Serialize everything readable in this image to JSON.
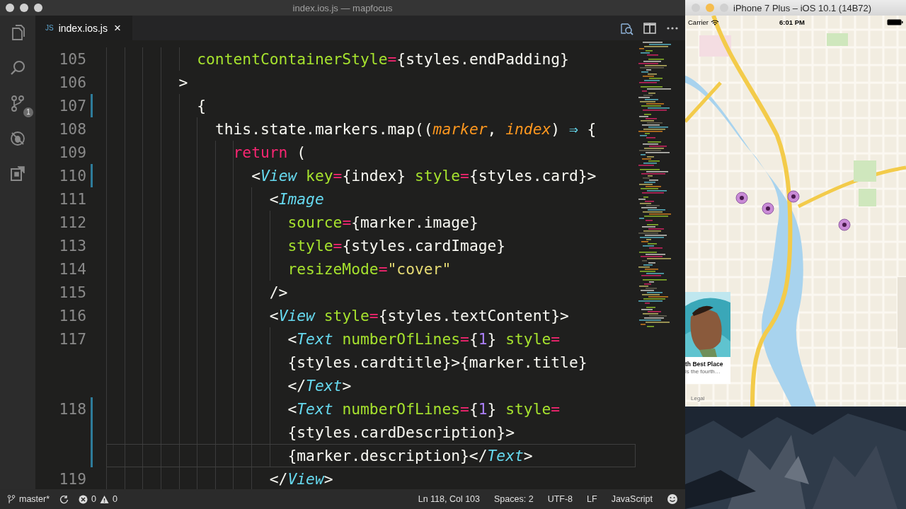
{
  "editor_window": {
    "title": "index.ios.js — mapfocus",
    "activity_bar": [
      {
        "kind": "files"
      },
      {
        "kind": "search"
      },
      {
        "kind": "git",
        "badge": "1"
      },
      {
        "kind": "debug"
      },
      {
        "kind": "extensions"
      }
    ],
    "tabs": [
      {
        "icon_text": "JS",
        "label": "index.ios.js",
        "close": "×",
        "selected": true
      }
    ],
    "editor_actions": [
      {
        "kind": "find"
      },
      {
        "kind": "split"
      },
      {
        "kind": "more"
      }
    ],
    "lines": [
      {
        "number": "105",
        "modified": false,
        "current": false,
        "tokens": [
          {
            "text": "          contentContainerStyle",
            "kind": "attr"
          },
          {
            "text": "=",
            "kind": "op"
          },
          {
            "text": "{styles.endPadding}",
            "kind": "punct"
          }
        ]
      },
      {
        "number": "106",
        "modified": false,
        "current": false,
        "tokens": [
          {
            "text": "        >",
            "kind": "punct"
          }
        ]
      },
      {
        "number": "107",
        "modified": true,
        "current": false,
        "tokens": [
          {
            "text": "          {",
            "kind": "punct"
          }
        ]
      },
      {
        "number": "108",
        "modified": false,
        "current": false,
        "tokens": [
          {
            "text": "            this.state.markers.map((",
            "kind": "punct"
          },
          {
            "text": "marker",
            "kind": "param"
          },
          {
            "text": ", ",
            "kind": "punct"
          },
          {
            "text": "index",
            "kind": "param"
          },
          {
            "text": ") ",
            "kind": "punct"
          },
          {
            "text": "⇒",
            "kind": "arrow"
          },
          {
            "text": " {",
            "kind": "punct"
          }
        ]
      },
      {
        "number": "109",
        "modified": false,
        "current": false,
        "tokens": [
          {
            "text": "              return",
            "kind": "keyword"
          },
          {
            "text": " (",
            "kind": "punct"
          }
        ]
      },
      {
        "number": "110",
        "modified": true,
        "current": false,
        "tokens": [
          {
            "text": "                <",
            "kind": "punct"
          },
          {
            "text": "View",
            "kind": "tag"
          },
          {
            "text": " key",
            "kind": "attr"
          },
          {
            "text": "=",
            "kind": "op"
          },
          {
            "text": "{index} ",
            "kind": "punct"
          },
          {
            "text": "style",
            "kind": "attr"
          },
          {
            "text": "=",
            "kind": "op"
          },
          {
            "text": "{styles.card}>",
            "kind": "punct"
          }
        ]
      },
      {
        "number": "111",
        "modified": false,
        "current": false,
        "tokens": [
          {
            "text": "                  <",
            "kind": "punct"
          },
          {
            "text": "Image",
            "kind": "tag"
          }
        ]
      },
      {
        "number": "112",
        "modified": false,
        "current": false,
        "tokens": [
          {
            "text": "                    source",
            "kind": "attr"
          },
          {
            "text": "=",
            "kind": "op"
          },
          {
            "text": "{marker.image}",
            "kind": "punct"
          }
        ]
      },
      {
        "number": "113",
        "modified": false,
        "current": false,
        "tokens": [
          {
            "text": "                    style",
            "kind": "attr"
          },
          {
            "text": "=",
            "kind": "op"
          },
          {
            "text": "{styles.cardImage}",
            "kind": "punct"
          }
        ]
      },
      {
        "number": "114",
        "modified": false,
        "current": false,
        "tokens": [
          {
            "text": "                    resizeMode",
            "kind": "attr"
          },
          {
            "text": "=",
            "kind": "op"
          },
          {
            "text": "\"cover\"",
            "kind": "string"
          }
        ]
      },
      {
        "number": "115",
        "modified": false,
        "current": false,
        "tokens": [
          {
            "text": "                  />",
            "kind": "punct"
          }
        ]
      },
      {
        "number": "116",
        "modified": false,
        "current": false,
        "tokens": [
          {
            "text": "                  <",
            "kind": "punct"
          },
          {
            "text": "View",
            "kind": "tag"
          },
          {
            "text": " style",
            "kind": "attr"
          },
          {
            "text": "=",
            "kind": "op"
          },
          {
            "text": "{styles.textContent}>",
            "kind": "punct"
          }
        ]
      },
      {
        "number": "117",
        "modified": false,
        "current": false,
        "tokens": [
          {
            "text": "                    <",
            "kind": "punct"
          },
          {
            "text": "Text",
            "kind": "tag"
          },
          {
            "text": " numberOfLines",
            "kind": "attr"
          },
          {
            "text": "=",
            "kind": "op"
          },
          {
            "text": "{",
            "kind": "punct"
          },
          {
            "text": "1",
            "kind": "number"
          },
          {
            "text": "} ",
            "kind": "punct"
          },
          {
            "text": "style",
            "kind": "attr"
          },
          {
            "text": "=",
            "kind": "op"
          }
        ]
      },
      {
        "modified": false,
        "current": false,
        "tokens": [
          {
            "text": "                    {styles.cardtitle}>{marker.title}",
            "kind": "punct"
          }
        ]
      },
      {
        "modified": false,
        "current": false,
        "tokens": [
          {
            "text": "                    </",
            "kind": "punct"
          },
          {
            "text": "Text",
            "kind": "tag"
          },
          {
            "text": ">",
            "kind": "punct"
          }
        ]
      },
      {
        "number": "118",
        "modified": true,
        "current": false,
        "tokens": [
          {
            "text": "                    <",
            "kind": "punct"
          },
          {
            "text": "Text",
            "kind": "tag"
          },
          {
            "text": " numberOfLines",
            "kind": "attr"
          },
          {
            "text": "=",
            "kind": "op"
          },
          {
            "text": "{",
            "kind": "punct"
          },
          {
            "text": "1",
            "kind": "number"
          },
          {
            "text": "} ",
            "kind": "punct"
          },
          {
            "text": "style",
            "kind": "attr"
          },
          {
            "text": "=",
            "kind": "op"
          }
        ]
      },
      {
        "modified": true,
        "current": false,
        "tokens": [
          {
            "text": "                    {styles.cardDescription}>",
            "kind": "punct"
          }
        ]
      },
      {
        "modified": true,
        "current": true,
        "tokens": [
          {
            "text": "                    {marker.description}</",
            "kind": "punct"
          },
          {
            "text": "Text",
            "kind": "tag"
          },
          {
            "text": ">",
            "kind": "punct"
          }
        ]
      },
      {
        "number": "119",
        "modified": false,
        "current": false,
        "tokens": [
          {
            "text": "                  </",
            "kind": "punct"
          },
          {
            "text": "View",
            "kind": "tag"
          },
          {
            "text": ">",
            "kind": "punct"
          }
        ]
      }
    ],
    "status_bar": {
      "branch": "master*",
      "errors": "0",
      "warnings": "0",
      "items": [
        "Ln 118, Col 103",
        "Spaces: 2",
        "UTF-8",
        "LF",
        "JavaScript"
      ]
    }
  },
  "simulator": {
    "title": "iPhone 7 Plus – iOS 10.1 (14B72)",
    "phone_status": {
      "carrier": "Carrier",
      "time": "6:01 PM"
    },
    "card": {
      "title": "th Best Place",
      "description": "is the fourth…"
    },
    "legal": "Legal"
  }
}
